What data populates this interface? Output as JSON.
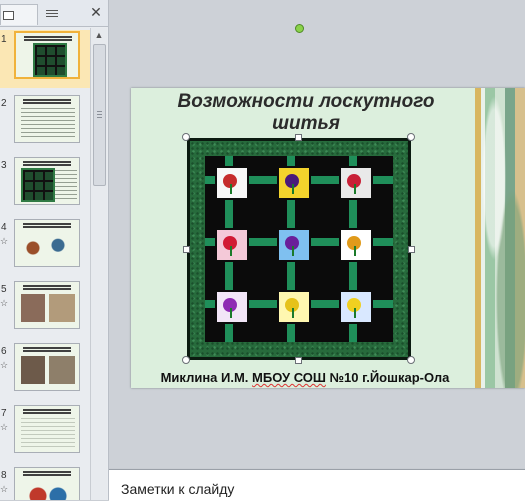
{
  "pane": {
    "slides": [
      {
        "num": "1",
        "star": "",
        "selected": true
      },
      {
        "num": "2",
        "star": ""
      },
      {
        "num": "3",
        "star": ""
      },
      {
        "num": "4",
        "star": "☆"
      },
      {
        "num": "5",
        "star": "☆"
      },
      {
        "num": "6",
        "star": "☆"
      },
      {
        "num": "7",
        "star": "☆"
      },
      {
        "num": "8",
        "star": "☆"
      }
    ]
  },
  "slide": {
    "title": "Возможности  лоскутного шитья",
    "footer_prefix": "Миклина И.М. ",
    "footer_underlined": "МБОУ СОШ",
    "footer_suffix": "  №10 г.Йошкар-Ола"
  },
  "notes": {
    "placeholder": "Заметки к слайду"
  },
  "colors": {
    "quilt_green": "#1f8f5a",
    "selection": "#f0b23b"
  }
}
